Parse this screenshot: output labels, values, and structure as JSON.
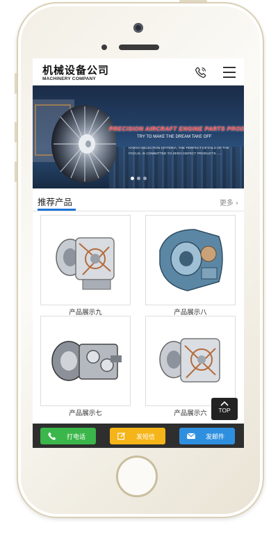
{
  "header": {
    "title": "机械设备公司",
    "subtitle": "MACHINERY COMPANY",
    "phone_icon": "phone-icon",
    "menu_icon": "hamburger-menu-icon"
  },
  "banner": {
    "title": "PRECISION AIRCRAFT ENGINE PARTS PRODUCTS",
    "subtitle": "TRY TO MAKE THE DREAM TAKE OFF",
    "line1": "HARSH SELECTION CRITERIA, THE PERFECT DETAILS OF THE",
    "line2": "FOCUS, IS COMMITTED TO ZERO DEFECT PRODUCTS ......",
    "slides": 3,
    "active_slide": 1
  },
  "section": {
    "title": "推荐产品",
    "more": "更多",
    "accent": "#1d74d8"
  },
  "products": [
    {
      "name": "产品展示九",
      "variant": "cutaway-silver"
    },
    {
      "name": "产品展示八",
      "variant": "blue-casing"
    },
    {
      "name": "产品展示七",
      "variant": "gear-assembly"
    },
    {
      "name": "产品展示六",
      "variant": "cutaway-silver"
    }
  ],
  "top_button": {
    "label": "TOP"
  },
  "bottom_bar": {
    "call": {
      "label": "打电话",
      "color": "#3bb64a"
    },
    "sms": {
      "label": "发短信",
      "color": "#f5b417"
    },
    "email": {
      "label": "发邮件",
      "color": "#2f8fdf"
    }
  }
}
